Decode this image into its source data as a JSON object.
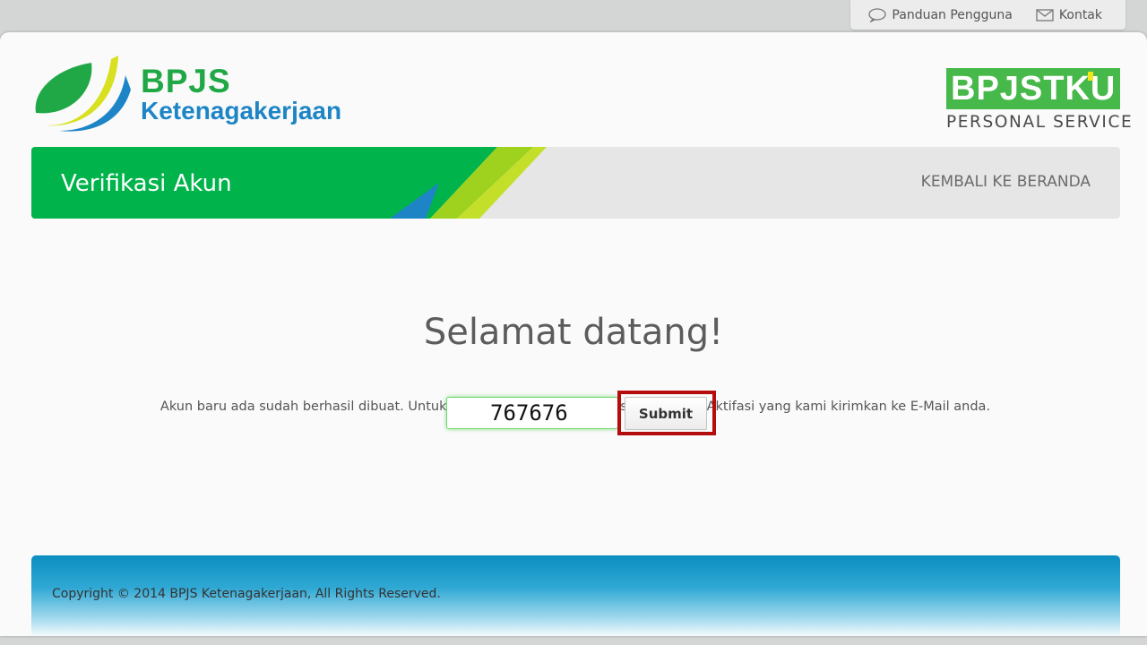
{
  "top_links": {
    "guide_label": "Panduan Pengguna",
    "contact_label": "Kontak"
  },
  "logo_left": {
    "brand": "BPJS",
    "sub": "Ketenagakerjaan"
  },
  "logo_right": {
    "brand": "BPJSTKU",
    "sub": "PERSONAL SERVICE"
  },
  "header_bar": {
    "title": "Verifikasi Akun",
    "back_link": "KEMBALI KE BERANDA"
  },
  "main": {
    "welcome": "Selamat datang!",
    "info": "Akun baru ada sudah berhasil dibuat. Untuk aktifasi akun, silahkan masukkan Kode Aktifasi yang kami kirimkan ke E-Mail anda.",
    "code_value": "767676",
    "submit_label": "Submit"
  },
  "footer": {
    "copyright": "Copyright © 2014 BPJS Ketenagakerjaan, All Rights Reserved."
  },
  "colors": {
    "brand_green": "#00b44b",
    "brand_blue": "#1d85c6",
    "highlight_red": "#b50d0d",
    "footer_blue": "#0b8ec0"
  }
}
